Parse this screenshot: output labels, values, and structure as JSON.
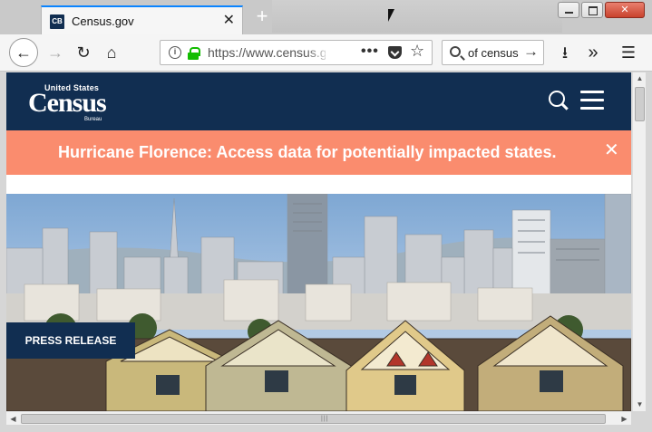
{
  "browser": {
    "tab": {
      "favicon_text": "CB",
      "title": "Census.gov",
      "close_glyph": "✕"
    },
    "new_tab_glyph": "+",
    "url": "https://www.census.g",
    "url_more": "•••",
    "search_text": "of census",
    "icons": {
      "back": "←",
      "forward": "→",
      "reload": "↻",
      "home": "⌂",
      "info": "i",
      "star": "☆",
      "search_go": "→",
      "download": "⭳",
      "overflow": "»",
      "menu": "☰"
    }
  },
  "site": {
    "logo_top": "United States",
    "logo_main": "Census",
    "logo_sub": "Bureau",
    "header_bg": "#112e51",
    "alert": {
      "text": "Hurricane Florence: Access data for potentially impacted states.",
      "close_glyph": "✕",
      "bg": "#fa8c6e"
    },
    "hero_badge": "PRESS RELEASE"
  },
  "scrollbars": {
    "v_up": "▲",
    "v_down": "▼",
    "h_left": "◀",
    "h_right": "▶",
    "grip": "|||"
  }
}
